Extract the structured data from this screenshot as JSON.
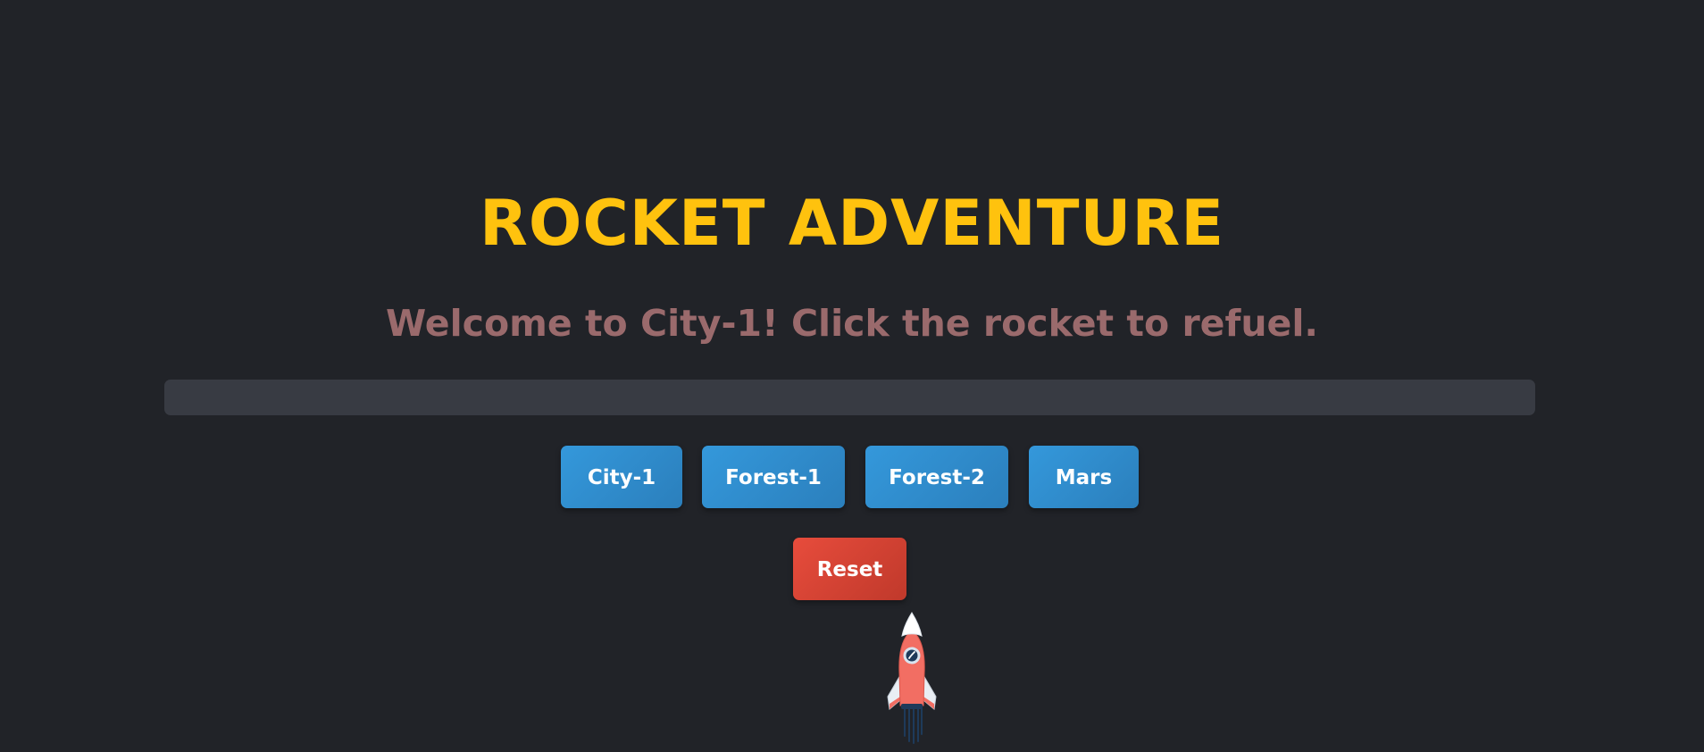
{
  "game": {
    "title": "ROCKET ADVENTURE",
    "message": "Welcome to City-1! Click the rocket to refuel.",
    "fuel_fraction": 0,
    "locations": [
      {
        "label": "City-1"
      },
      {
        "label": "Forest-1"
      },
      {
        "label": "Forest-2"
      },
      {
        "label": "Mars"
      }
    ],
    "reset_label": "Reset",
    "rocket_icon": "rocket-icon"
  },
  "colors": {
    "background": "#212328",
    "title": "#ffc20e",
    "message": "#9a6a6c",
    "location_button": "#3498db",
    "reset_button": "#e74c3c",
    "fuel_track": "#383b43"
  }
}
